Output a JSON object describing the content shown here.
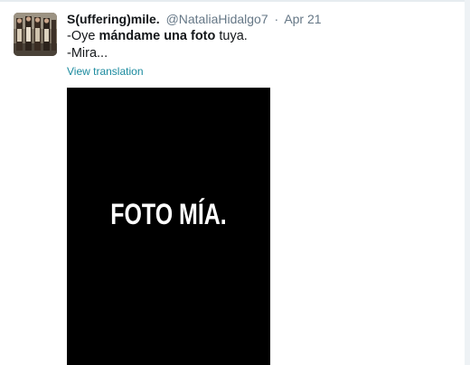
{
  "tweet": {
    "display_name": "S(uffering)mile.",
    "handle": "@NataliaHidalgo7",
    "separator": "·",
    "date": "Apr 21",
    "text_line1": {
      "part1": "-Oye ",
      "bold1": "mándame",
      "part2": " ",
      "bold2": "una",
      "part3": " ",
      "bold3": "foto",
      "part4": " tuya."
    },
    "text_line2": "-Mira...",
    "translation_link": "View translation",
    "media_caption": "FOTO MÍA."
  },
  "colors": {
    "name": "#14171a",
    "secondary": "#657786",
    "link": "#1a8a9e",
    "media_background": "#000000"
  },
  "icons": {
    "avatar": "profile-photo"
  }
}
